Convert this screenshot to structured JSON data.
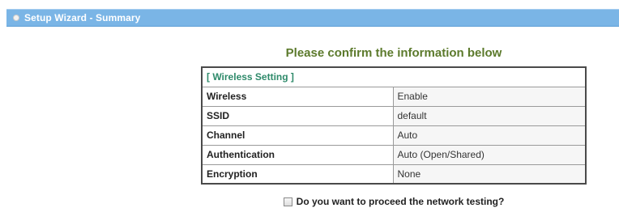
{
  "header": {
    "title": "Setup Wizard - Summary",
    "icon": "circle-bullet-icon",
    "background_color": "#7ab5e6"
  },
  "main": {
    "heading": "Please confirm the information below",
    "section_label": "[ Wireless Setting ]",
    "rows": [
      {
        "label": "Wireless",
        "value": "Enable"
      },
      {
        "label": "SSID",
        "value": "default"
      },
      {
        "label": "Channel",
        "value": "Auto"
      },
      {
        "label": "Authentication",
        "value": "Auto (Open/Shared)"
      },
      {
        "label": "Encryption",
        "value": "None"
      }
    ],
    "network_test": {
      "label": "Do you want to proceed the network testing?",
      "checked": false
    }
  },
  "colors": {
    "heading": "#5c7a2c",
    "section_label": "#2e8a6a"
  }
}
